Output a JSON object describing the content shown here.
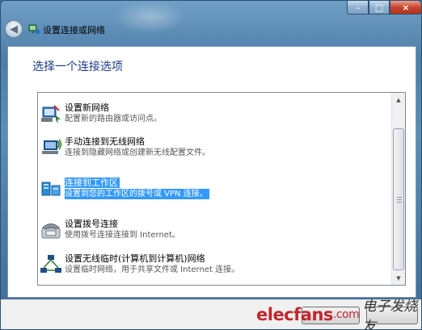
{
  "window": {
    "title": "设置连接或网络",
    "controls": {
      "minimize": "–",
      "maximize": "□",
      "close": "×"
    }
  },
  "main": {
    "heading": "选择一个连接选项",
    "options": [
      {
        "title": "设置新网络",
        "desc": "配置新的路由器或访问点。",
        "icon": "router-setup-icon",
        "selected": false
      },
      {
        "title": "手动连接到无线网络",
        "desc": "连接到隐藏网络或创建新无线配置文件。",
        "icon": "wireless-manual-icon",
        "selected": false
      },
      {
        "title": "连接到工作区",
        "desc": "设置到您的工作区的拨号或 VPN 连接。",
        "icon": "workplace-connection-icon",
        "selected": true
      },
      {
        "title": "设置拨号连接",
        "desc": "使用拨号连接连接到 Internet。",
        "icon": "dialup-phone-icon",
        "selected": false
      },
      {
        "title": "设置无线临时(计算机到计算机)网络",
        "desc": "设置临时网络，用于共享文件或 Internet 连接。",
        "icon": "adhoc-network-icon",
        "selected": false
      }
    ]
  },
  "footer": {
    "watermark": "elecfans",
    "watermark_suffix": ".com",
    "watermark_cn": "电子发烧友"
  },
  "colors": {
    "selection": "#3399ff",
    "heading": "#1e3a8a",
    "watermark": "#c1272d"
  }
}
